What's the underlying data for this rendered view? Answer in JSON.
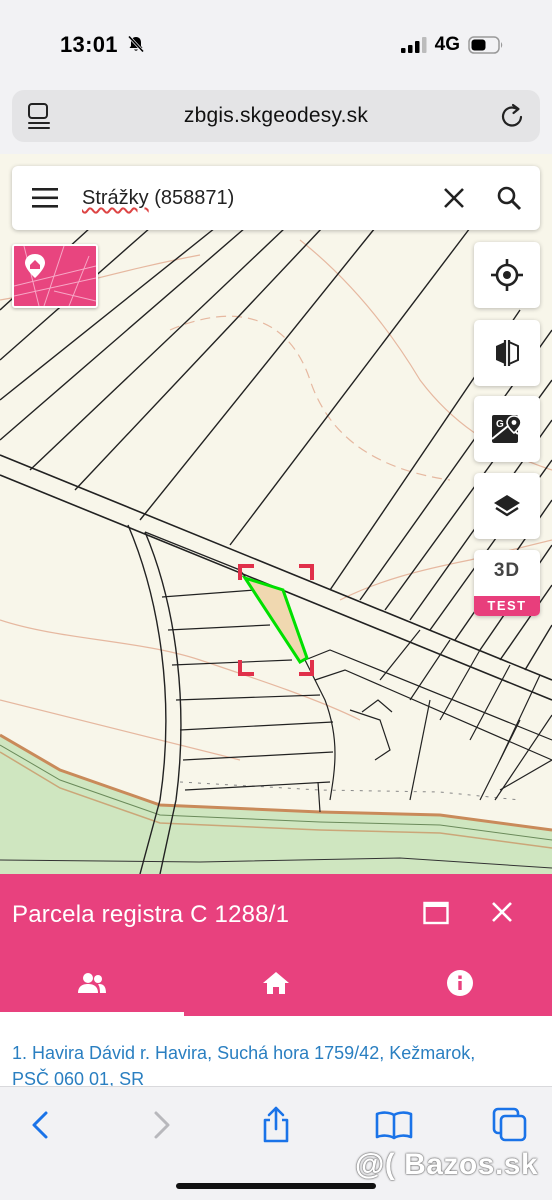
{
  "status_bar": {
    "time": "13:01",
    "network": "4G"
  },
  "browser": {
    "url": "zbgis.skgeodesy.sk"
  },
  "search": {
    "query": "Strážky",
    "query_code": " (858871)"
  },
  "map_controls": {
    "btn_3d_label": "3D",
    "btn_3d_badge": "TEST"
  },
  "panel": {
    "title": "Parcela registra C 1288/1",
    "tabs": [
      "owners",
      "home",
      "info"
    ],
    "owner_line_1": "1. Havira Dávid r. Havira, Suchá hora 1759/42, Kežmarok,",
    "owner_line_2": "PSČ 060 01, SR"
  },
  "watermark": "@( Bazos.sk",
  "colors": {
    "accent": "#e8417e",
    "map_bg": "#f8f6ea",
    "forest": "#cfe6c0",
    "selection": "#00e000",
    "link": "#2a7fc1"
  }
}
